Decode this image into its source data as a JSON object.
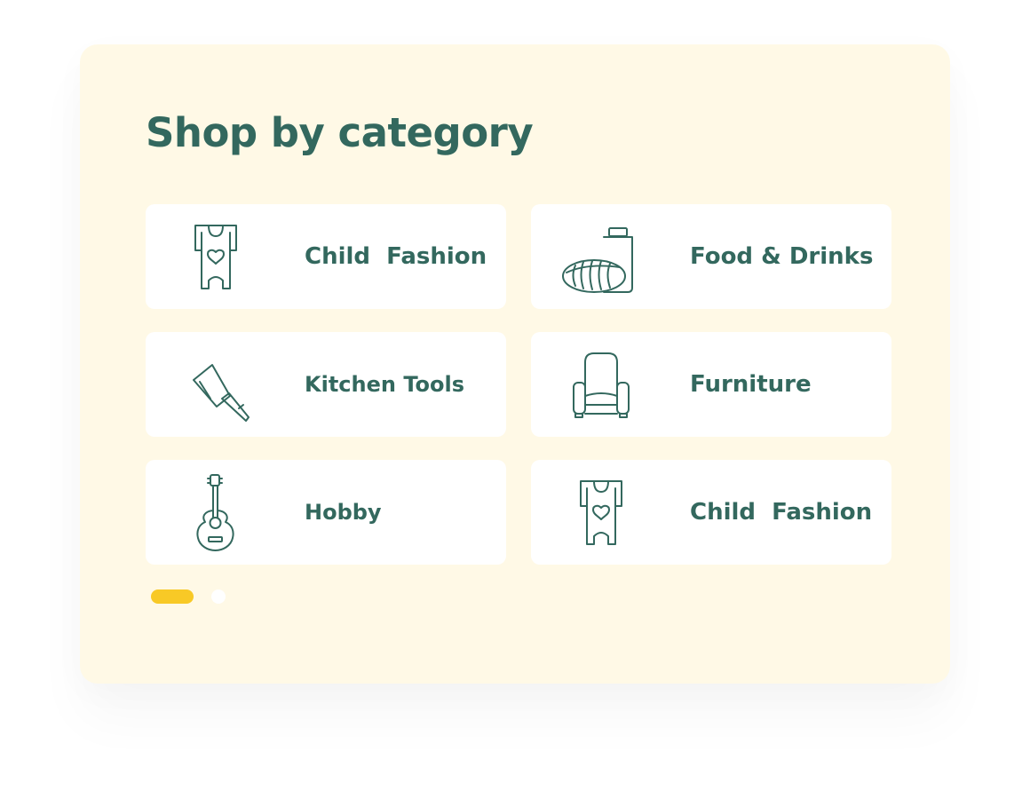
{
  "theme": {
    "panel_bg": "#fff9e6",
    "text_color": "#33685e",
    "icon_stroke": "#33685e",
    "card_bg": "#ffffff",
    "pager_active": "#f8c926",
    "pager_inactive": "#ffffff"
  },
  "section": {
    "title": "Shop by category"
  },
  "categories": [
    {
      "label": "Child  Fashion",
      "icon": "baby-romper-icon"
    },
    {
      "label": "Food & Drinks",
      "icon": "bread-and-milk-icon"
    },
    {
      "label": "Kitchen Tools",
      "icon": "cleaver-knife-icon"
    },
    {
      "label": "Furniture",
      "icon": "armchair-icon"
    },
    {
      "label": "Hobby",
      "icon": "guitar-icon"
    },
    {
      "label": "Child  Fashion",
      "icon": "baby-romper-icon"
    }
  ],
  "pagination": {
    "total_pages": 2,
    "current_page": 1
  }
}
